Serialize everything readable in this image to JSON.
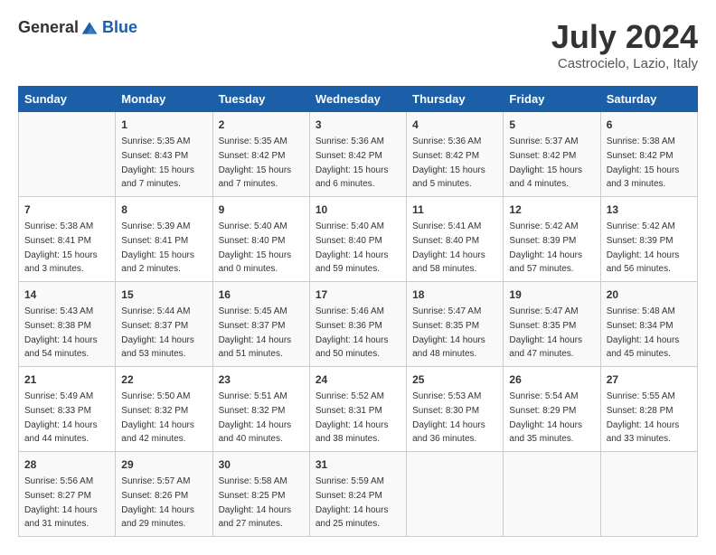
{
  "header": {
    "logo_general": "General",
    "logo_blue": "Blue",
    "month_title": "July 2024",
    "location": "Castrocielo, Lazio, Italy"
  },
  "days_of_week": [
    "Sunday",
    "Monday",
    "Tuesday",
    "Wednesday",
    "Thursday",
    "Friday",
    "Saturday"
  ],
  "weeks": [
    [
      {
        "day": "",
        "info": ""
      },
      {
        "day": "1",
        "info": "Sunrise: 5:35 AM\nSunset: 8:43 PM\nDaylight: 15 hours\nand 7 minutes."
      },
      {
        "day": "2",
        "info": "Sunrise: 5:35 AM\nSunset: 8:42 PM\nDaylight: 15 hours\nand 7 minutes."
      },
      {
        "day": "3",
        "info": "Sunrise: 5:36 AM\nSunset: 8:42 PM\nDaylight: 15 hours\nand 6 minutes."
      },
      {
        "day": "4",
        "info": "Sunrise: 5:36 AM\nSunset: 8:42 PM\nDaylight: 15 hours\nand 5 minutes."
      },
      {
        "day": "5",
        "info": "Sunrise: 5:37 AM\nSunset: 8:42 PM\nDaylight: 15 hours\nand 4 minutes."
      },
      {
        "day": "6",
        "info": "Sunrise: 5:38 AM\nSunset: 8:42 PM\nDaylight: 15 hours\nand 3 minutes."
      }
    ],
    [
      {
        "day": "7",
        "info": "Sunrise: 5:38 AM\nSunset: 8:41 PM\nDaylight: 15 hours\nand 3 minutes."
      },
      {
        "day": "8",
        "info": "Sunrise: 5:39 AM\nSunset: 8:41 PM\nDaylight: 15 hours\nand 2 minutes."
      },
      {
        "day": "9",
        "info": "Sunrise: 5:40 AM\nSunset: 8:40 PM\nDaylight: 15 hours\nand 0 minutes."
      },
      {
        "day": "10",
        "info": "Sunrise: 5:40 AM\nSunset: 8:40 PM\nDaylight: 14 hours\nand 59 minutes."
      },
      {
        "day": "11",
        "info": "Sunrise: 5:41 AM\nSunset: 8:40 PM\nDaylight: 14 hours\nand 58 minutes."
      },
      {
        "day": "12",
        "info": "Sunrise: 5:42 AM\nSunset: 8:39 PM\nDaylight: 14 hours\nand 57 minutes."
      },
      {
        "day": "13",
        "info": "Sunrise: 5:42 AM\nSunset: 8:39 PM\nDaylight: 14 hours\nand 56 minutes."
      }
    ],
    [
      {
        "day": "14",
        "info": "Sunrise: 5:43 AM\nSunset: 8:38 PM\nDaylight: 14 hours\nand 54 minutes."
      },
      {
        "day": "15",
        "info": "Sunrise: 5:44 AM\nSunset: 8:37 PM\nDaylight: 14 hours\nand 53 minutes."
      },
      {
        "day": "16",
        "info": "Sunrise: 5:45 AM\nSunset: 8:37 PM\nDaylight: 14 hours\nand 51 minutes."
      },
      {
        "day": "17",
        "info": "Sunrise: 5:46 AM\nSunset: 8:36 PM\nDaylight: 14 hours\nand 50 minutes."
      },
      {
        "day": "18",
        "info": "Sunrise: 5:47 AM\nSunset: 8:35 PM\nDaylight: 14 hours\nand 48 minutes."
      },
      {
        "day": "19",
        "info": "Sunrise: 5:47 AM\nSunset: 8:35 PM\nDaylight: 14 hours\nand 47 minutes."
      },
      {
        "day": "20",
        "info": "Sunrise: 5:48 AM\nSunset: 8:34 PM\nDaylight: 14 hours\nand 45 minutes."
      }
    ],
    [
      {
        "day": "21",
        "info": "Sunrise: 5:49 AM\nSunset: 8:33 PM\nDaylight: 14 hours\nand 44 minutes."
      },
      {
        "day": "22",
        "info": "Sunrise: 5:50 AM\nSunset: 8:32 PM\nDaylight: 14 hours\nand 42 minutes."
      },
      {
        "day": "23",
        "info": "Sunrise: 5:51 AM\nSunset: 8:32 PM\nDaylight: 14 hours\nand 40 minutes."
      },
      {
        "day": "24",
        "info": "Sunrise: 5:52 AM\nSunset: 8:31 PM\nDaylight: 14 hours\nand 38 minutes."
      },
      {
        "day": "25",
        "info": "Sunrise: 5:53 AM\nSunset: 8:30 PM\nDaylight: 14 hours\nand 36 minutes."
      },
      {
        "day": "26",
        "info": "Sunrise: 5:54 AM\nSunset: 8:29 PM\nDaylight: 14 hours\nand 35 minutes."
      },
      {
        "day": "27",
        "info": "Sunrise: 5:55 AM\nSunset: 8:28 PM\nDaylight: 14 hours\nand 33 minutes."
      }
    ],
    [
      {
        "day": "28",
        "info": "Sunrise: 5:56 AM\nSunset: 8:27 PM\nDaylight: 14 hours\nand 31 minutes."
      },
      {
        "day": "29",
        "info": "Sunrise: 5:57 AM\nSunset: 8:26 PM\nDaylight: 14 hours\nand 29 minutes."
      },
      {
        "day": "30",
        "info": "Sunrise: 5:58 AM\nSunset: 8:25 PM\nDaylight: 14 hours\nand 27 minutes."
      },
      {
        "day": "31",
        "info": "Sunrise: 5:59 AM\nSunset: 8:24 PM\nDaylight: 14 hours\nand 25 minutes."
      },
      {
        "day": "",
        "info": ""
      },
      {
        "day": "",
        "info": ""
      },
      {
        "day": "",
        "info": ""
      }
    ]
  ]
}
